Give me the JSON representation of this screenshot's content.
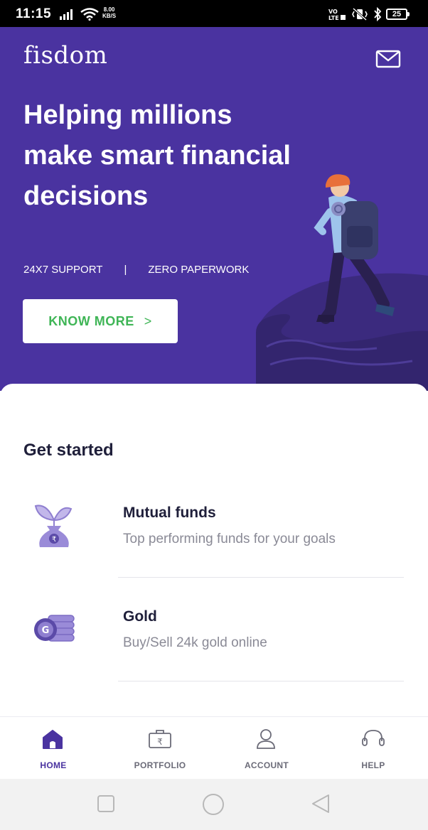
{
  "status_bar": {
    "time": "11:15",
    "speed_value": "8.00",
    "speed_unit": "KB/S",
    "battery": "25"
  },
  "header": {
    "logo": "fisdom",
    "mail_icon": "mail-icon"
  },
  "hero": {
    "title": "Helping millions make smart financial decisions",
    "tag_1": "24X7 SUPPORT",
    "separator": "|",
    "tag_2": "ZERO PAPERWORK",
    "cta_label": "KNOW MORE",
    "cta_chevron": ">"
  },
  "main": {
    "section_title": "Get started",
    "products": [
      {
        "title": "Mutual funds",
        "subtitle": "Top performing funds for your goals",
        "icon": "money-bag-plant-icon"
      },
      {
        "title": "Gold",
        "subtitle": "Buy/Sell 24k gold online",
        "icon": "gold-coins-icon"
      }
    ]
  },
  "bottom_nav": {
    "items": [
      {
        "label": "HOME",
        "icon": "home-icon",
        "active": true
      },
      {
        "label": "PORTFOLIO",
        "icon": "briefcase-icon",
        "active": false
      },
      {
        "label": "ACCOUNT",
        "icon": "user-icon",
        "active": false
      },
      {
        "label": "HELP",
        "icon": "headset-icon",
        "active": false
      }
    ]
  },
  "colors": {
    "brand_purple": "#4a33a0",
    "cta_green": "#3fb556",
    "icon_lavender": "#8f7fd0"
  }
}
